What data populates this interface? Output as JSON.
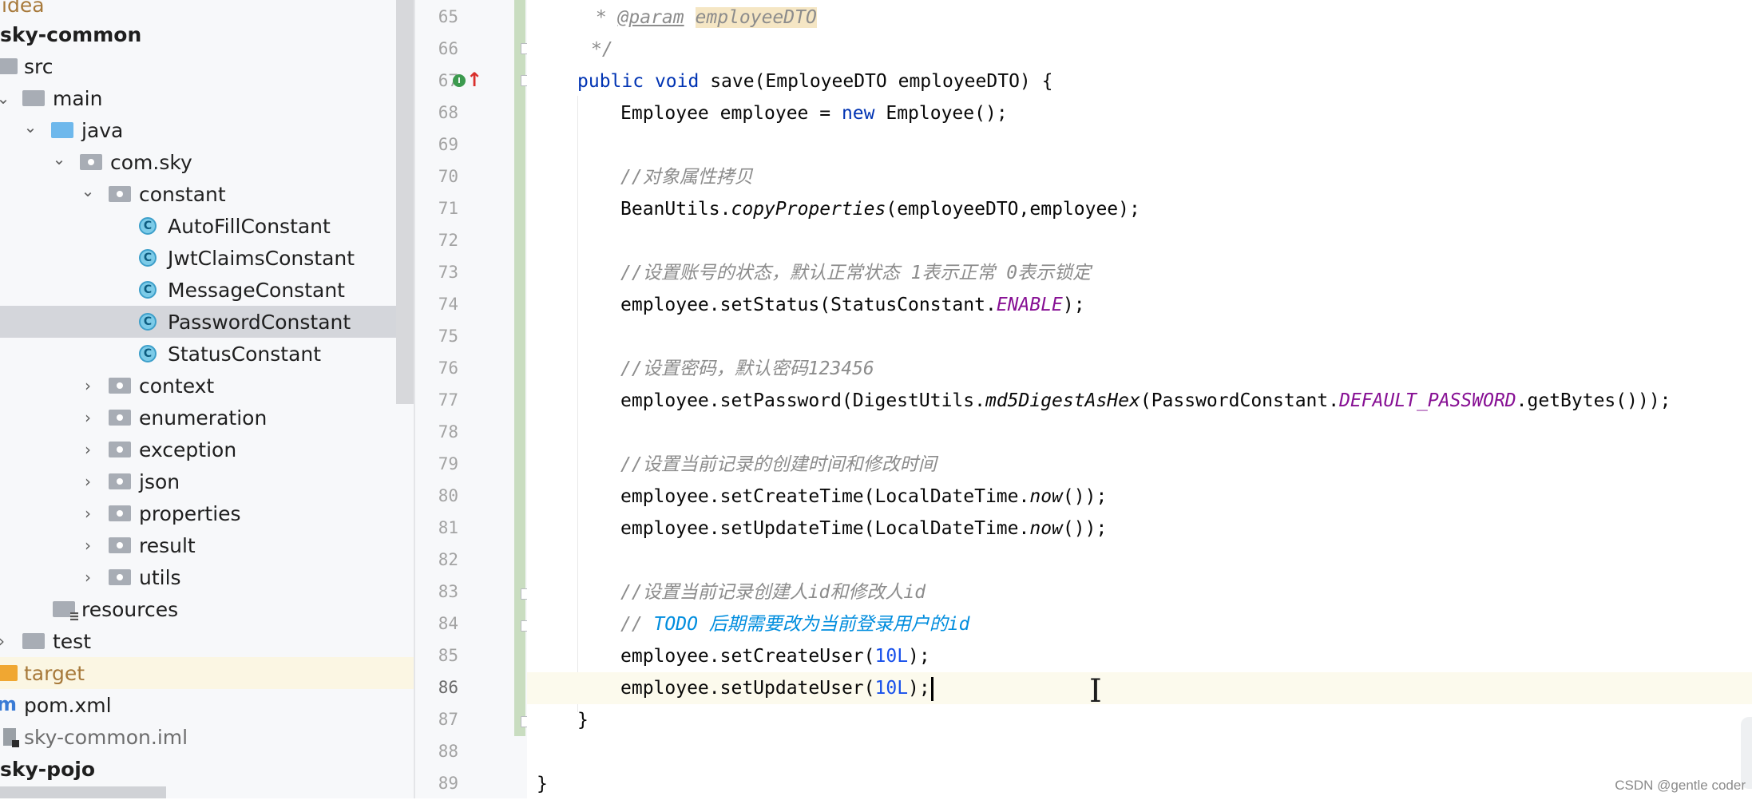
{
  "project_tree": {
    "items": [
      {
        "label": "idea",
        "kind": "folder"
      },
      {
        "label": "sky-common",
        "kind": "module"
      },
      {
        "label": "src",
        "kind": "folder"
      },
      {
        "label": "main",
        "kind": "folder"
      },
      {
        "label": "java",
        "kind": "source-root"
      },
      {
        "label": "com.sky",
        "kind": "package"
      },
      {
        "label": "constant",
        "kind": "package"
      },
      {
        "label": "AutoFillConstant",
        "kind": "class"
      },
      {
        "label": "JwtClaimsConstant",
        "kind": "class"
      },
      {
        "label": "MessageConstant",
        "kind": "class"
      },
      {
        "label": "PasswordConstant",
        "kind": "class",
        "selected": true
      },
      {
        "label": "StatusConstant",
        "kind": "class"
      },
      {
        "label": "context",
        "kind": "package"
      },
      {
        "label": "enumeration",
        "kind": "package"
      },
      {
        "label": "exception",
        "kind": "package"
      },
      {
        "label": "json",
        "kind": "package"
      },
      {
        "label": "properties",
        "kind": "package"
      },
      {
        "label": "result",
        "kind": "package"
      },
      {
        "label": "utils",
        "kind": "package"
      },
      {
        "label": "resources",
        "kind": "resources-root"
      },
      {
        "label": "test",
        "kind": "folder"
      },
      {
        "label": "target",
        "kind": "excluded-folder"
      },
      {
        "label": "pom.xml",
        "kind": "maven-file",
        "icon": "m"
      },
      {
        "label": "sky-common.iml",
        "kind": "iml-file"
      },
      {
        "label": "sky-pojo",
        "kind": "module"
      }
    ]
  },
  "gutter": {
    "line_numbers": [
      "65",
      "66",
      "67",
      "68",
      "69",
      "70",
      "71",
      "72",
      "73",
      "74",
      "75",
      "76",
      "77",
      "78",
      "79",
      "80",
      "81",
      "82",
      "83",
      "84",
      "85",
      "86",
      "87",
      "88",
      "89"
    ],
    "impl_icon_letter": "I",
    "impl_arrow": "↑"
  },
  "code": {
    "l65": {
      "prefix": " * ",
      "tag": "@param",
      "space": " ",
      "param": "employeeDTO"
    },
    "l66": "*/",
    "l67": {
      "kw1": "public",
      "kw2": "void",
      "rest": " save(EmployeeDTO employeeDTO) {"
    },
    "l68": {
      "a": "Employee employee = ",
      "kw": "new",
      "b": " Employee();"
    },
    "l70": "//对象属性拷贝",
    "l71": {
      "a": "BeanUtils.",
      "it": "copyProperties",
      "b": "(employeeDTO,employee);"
    },
    "l73": "//设置账号的状态，默认正常状态 1表示正常 0表示锁定",
    "l74": {
      "a": "employee.setStatus(StatusConstant.",
      "c": "ENABLE",
      "b": ");"
    },
    "l76": "//设置密码，默认密码123456",
    "l77": {
      "a": "employee.setPassword(DigestUtils.",
      "it": "md5DigestAsHex",
      "b": "(PasswordConstant.",
      "c": "DEFAULT_PASSWORD",
      "d": ".getBytes()));"
    },
    "l79": "//设置当前记录的创建时间和修改时间",
    "l80": {
      "a": "employee.setCreateTime(LocalDateTime.",
      "it": "now",
      "b": "());"
    },
    "l81": {
      "a": "employee.setUpdateTime(LocalDateTime.",
      "it": "now",
      "b": "());"
    },
    "l83": "//设置当前记录创建人id和修改人id",
    "l84": {
      "slash": "// ",
      "todo": "TODO 后期需要改为当前登录用户的id"
    },
    "l85": {
      "a": "employee.setCreateUser(",
      "n": "10L",
      "b": ");"
    },
    "l86": {
      "a": "employee.setUpdateUser(",
      "n": "10L",
      "b": ");"
    },
    "l87": "}",
    "l89": "}"
  },
  "watermark": "CSDN @gentle coder",
  "colors": {
    "keyword": "#0033b3",
    "comment": "#8c8c8c",
    "todo": "#008dde",
    "constant": "#871094",
    "number": "#1750eb",
    "selected_row": "#d4d6db",
    "change_bar": "#c9ddc0"
  }
}
